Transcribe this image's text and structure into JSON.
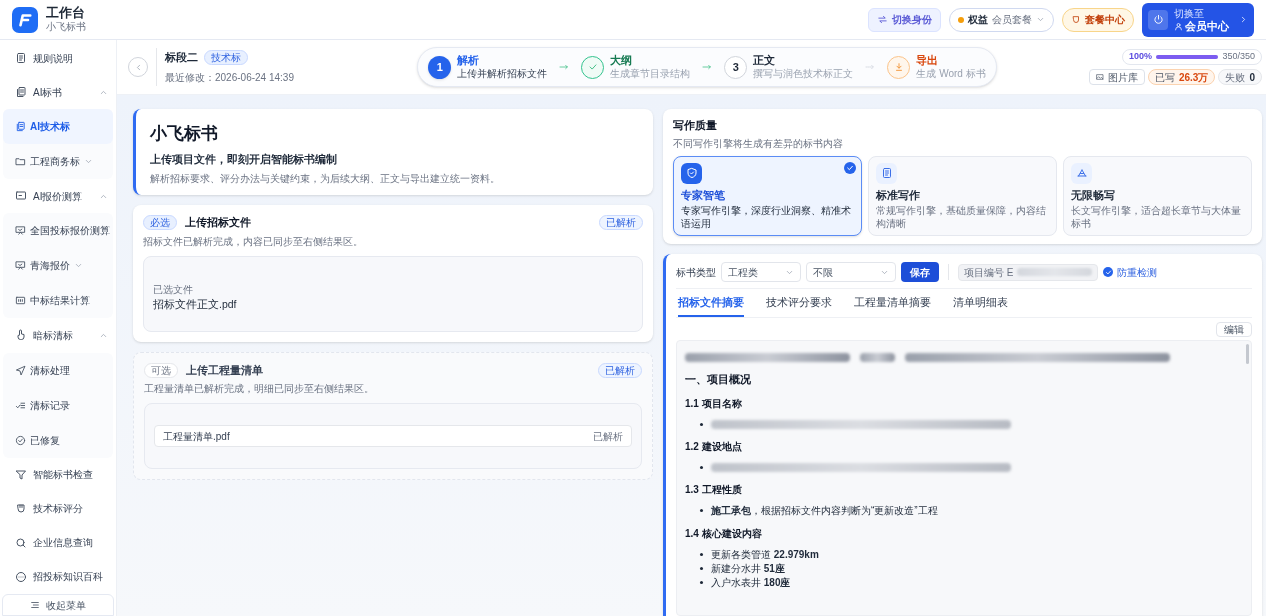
{
  "app": {
    "title": "工作台",
    "subtitle": "小飞标书"
  },
  "header_actions": {
    "switch_identity": "切换身份",
    "benefits": {
      "label": "权益",
      "value": "会员套餐"
    },
    "package_center": "套餐中心",
    "member": {
      "caption": "切换至",
      "label": "会员中心"
    }
  },
  "sidebar": {
    "items": [
      {
        "label": "规则说明"
      },
      {
        "label": "AI标书",
        "expanded": true,
        "children": [
          {
            "label": "AI技术标",
            "selected": true
          },
          {
            "label": "工程商务标",
            "selected": false,
            "expanded": false
          }
        ]
      },
      {
        "label": "AI报价测算",
        "expanded": true,
        "children": [
          {
            "label": "全国投标报价测算",
            "selected": false
          },
          {
            "label": "青海报价",
            "selected": false,
            "expanded": false
          },
          {
            "label": "中标结果计算",
            "selected": false
          }
        ]
      },
      {
        "label": "暗标清标",
        "expanded": true,
        "children": [
          {
            "label": "清标处理",
            "selected": false
          },
          {
            "label": "清标记录",
            "selected": false
          },
          {
            "label": "已修复",
            "selected": false
          }
        ]
      },
      {
        "label": "智能标书检查"
      },
      {
        "label": "技术标评分"
      },
      {
        "label": "企业信息查询"
      },
      {
        "label": "招投标知识百科"
      }
    ],
    "collapse": "收起菜单"
  },
  "project": {
    "name": "标段二",
    "tag": "技术标",
    "modified": "最近修改：2026-06-24 14:39"
  },
  "steps": [
    {
      "number": "1",
      "title": "解析",
      "caption": "上传并解析招标文件",
      "active": true,
      "done": false
    },
    {
      "title": "大纲",
      "caption": "生成章节目录结构",
      "active": false,
      "done": true
    },
    {
      "number": "3",
      "title": "正文",
      "caption": "撰写与润色技术标正文",
      "active": false,
      "done": false
    },
    {
      "title": "导出",
      "caption": "生成 Word 标书",
      "active": false,
      "done": false
    }
  ],
  "progress": {
    "percent": "100%",
    "level": 1,
    "count": "350/350"
  },
  "stats": {
    "gallery": "图片库",
    "written_label": "已写",
    "written_value": "26.3万",
    "failed_label": "失败",
    "failed_value": "0"
  },
  "intro": {
    "title": "小飞标书",
    "subtitle": "上传项目文件，即刻开启智能标书编制",
    "description": "解析招标要求、评分办法与关键约束，为后续大纲、正文与导出建立统一资料。"
  },
  "uploads": [
    {
      "badge": "必选",
      "required": true,
      "title": "上传招标文件",
      "status": "已解析",
      "description": "招标文件已解析完成，内容已同步至右侧结果区。",
      "file_caption": "已选文件",
      "file": "招标文件正文.pdf"
    },
    {
      "badge": "可选",
      "required": false,
      "title": "上传工程量清单",
      "status": "已解析",
      "description": "工程量清单已解析完成，明细已同步至右侧结果区。",
      "file": "工程量清单.pdf",
      "file_status": "已解析"
    }
  ],
  "quality": {
    "title": "写作质量",
    "description": "不同写作引擎将生成有差异的标书内容",
    "options": [
      {
        "title": "专家智笔",
        "description": "专家写作引擎，深度行业洞察、精准术语运用",
        "selected": true
      },
      {
        "title": "标准写作",
        "description": "常规写作引擎，基础质量保障，内容结构清晰",
        "selected": false
      },
      {
        "title": "无限畅写",
        "description": "长文写作引擎，适合超长章节与大体量标书",
        "selected": false
      }
    ]
  },
  "toolbar": {
    "type_label": "标书类型",
    "type_value": "工程类",
    "scope_value": "不限",
    "save": "保存",
    "project_no": "项目编号 E",
    "duplicate_check": {
      "label": "防重检测",
      "checked": true
    }
  },
  "tabs": [
    {
      "label": "招标文件摘要",
      "selected": true
    },
    {
      "label": "技术评分要求",
      "selected": false
    },
    {
      "label": "工程量清单摘要",
      "selected": false
    },
    {
      "label": "清单明细表",
      "selected": false
    }
  ],
  "edit": "编辑",
  "document": [
    {
      "kind": "redacted"
    },
    {
      "kind": "h2",
      "text": "一、项目概况"
    },
    {
      "kind": "h3",
      "text": "1.1 项目名称"
    },
    {
      "kind": "redacted_bullet"
    },
    {
      "kind": "h3",
      "text": "1.2 建设地点"
    },
    {
      "kind": "redacted_bullet"
    },
    {
      "kind": "h3",
      "text": "1.3 工程性质"
    },
    {
      "kind": "bullets",
      "items": [
        "**施工承包**，根据招标文件内容判断为“更新改造”工程"
      ]
    },
    {
      "kind": "h3",
      "text": "1.4 核心建设内容"
    },
    {
      "kind": "bullets",
      "items": [
        "更新各类管道 **22.979km**",
        "新建分水井 **51座**",
        "入户水表井 **180座**"
      ]
    }
  ]
}
